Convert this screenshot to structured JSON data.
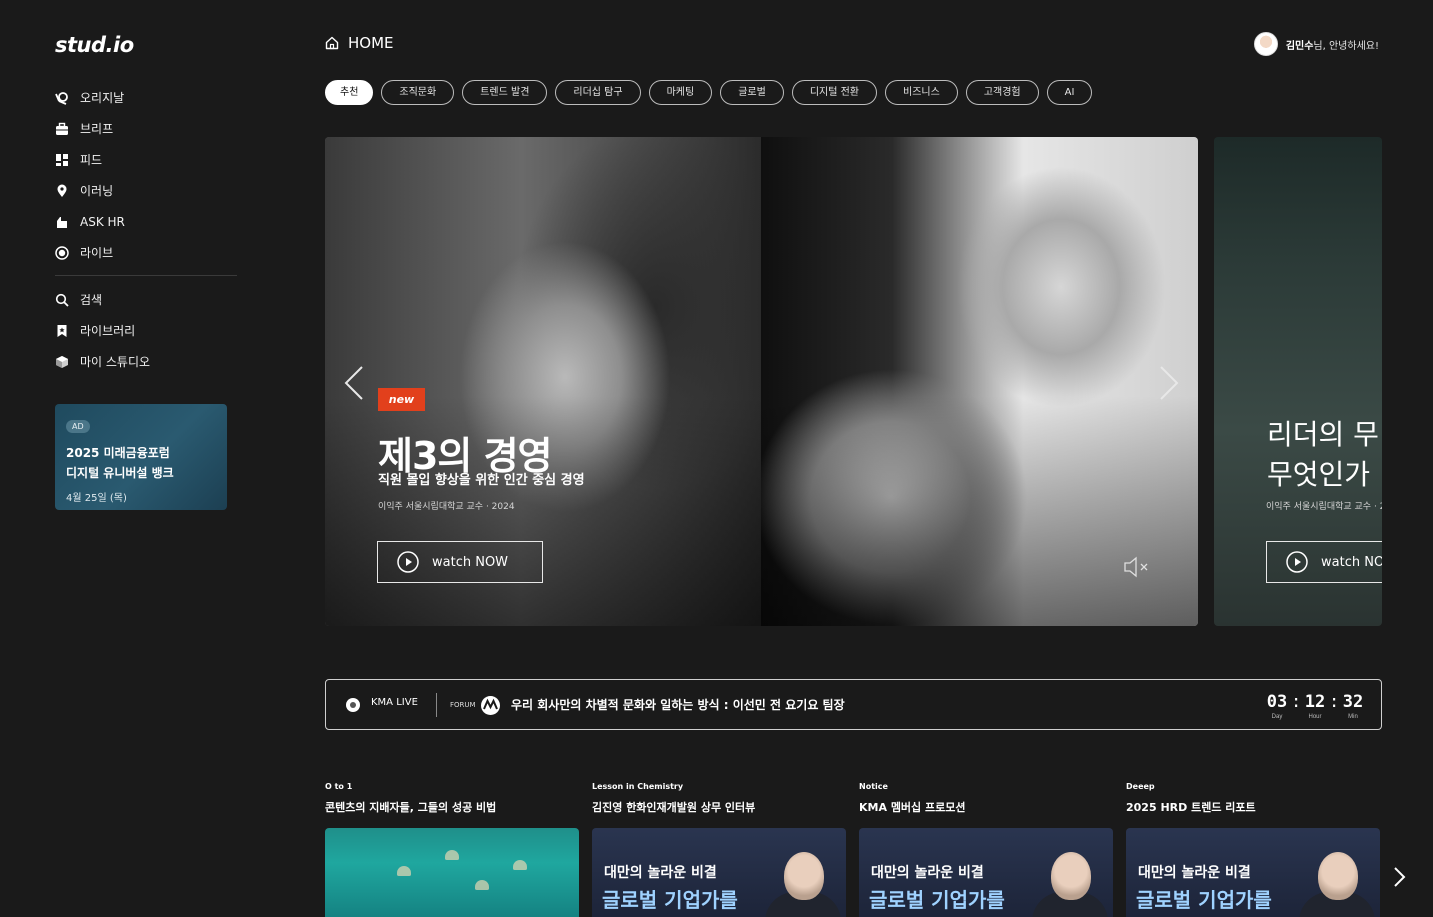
{
  "brand": {
    "logo": "stud.io"
  },
  "sidebar": {
    "main_items": [
      {
        "label": "오리지날",
        "icon": "original-icon"
      },
      {
        "label": "브리프",
        "icon": "briefcase-icon"
      },
      {
        "label": "피드",
        "icon": "grid-icon"
      },
      {
        "label": "이러닝",
        "icon": "pin-icon"
      },
      {
        "label": "ASK HR",
        "icon": "hand-icon"
      },
      {
        "label": "라이브",
        "icon": "live-icon"
      }
    ],
    "sub_items": [
      {
        "label": "검색",
        "icon": "search-icon"
      },
      {
        "label": "라이브러리",
        "icon": "bookmark-icon"
      },
      {
        "label": "마이 스튜디오",
        "icon": "cube-icon"
      }
    ],
    "ad": {
      "badge": "AD",
      "title_line1": "2025 미래금융포럼",
      "title_line2": "디지털 유니버설 뱅크",
      "date": "4월 25일 (목)"
    }
  },
  "header": {
    "home_label": "HOME",
    "user_name": "김민수",
    "user_greeting": "님, 안녕하세요!"
  },
  "categories": [
    "추천",
    "조직문화",
    "트렌드 발견",
    "리더십 탐구",
    "마케팅",
    "글로벌",
    "디지털 전환",
    "비즈니스",
    "고객경험",
    "AI"
  ],
  "active_category": "추천",
  "hero": {
    "badge": "new",
    "title": "제3의 경영",
    "subtitle": "직원 몰입 향상을 위한 인간 중심 경영",
    "meta": "이익주 서울시립대학교 교수 · 2024",
    "watch_label": "watch NOW"
  },
  "peek": {
    "title_line1": "리더의 무",
    "title_line2": "무엇인가",
    "meta": "이익주 서울시립대학교 교수 · 2",
    "watch_label": "watch NO"
  },
  "live": {
    "label": "KMA LIVE",
    "forum": "FORUM",
    "title": "우리 회사만의 차별적 문화와 일하는 방식 : 이선민 전 요기요 팀장",
    "timer": {
      "day": "03",
      "hour": "12",
      "min": "32",
      "day_label": "Day",
      "hour_label": "Hour",
      "min_label": "Min"
    }
  },
  "cards": [
    {
      "category": "O to 1",
      "title": "콘텐츠의 지배자들, 그들의 성공 비법",
      "image": "sea"
    },
    {
      "category": "Lesson in Chemistry",
      "title": "김진영 한화인재개발원 상무 인터뷰",
      "image": "talk",
      "overlay1": "대만의 놀라운 비결",
      "overlay2": "글로벌 기업가를"
    },
    {
      "category": "Notice",
      "title": "KMA 멤버십 프로모션",
      "image": "talk",
      "overlay1": "대만의 놀라운 비결",
      "overlay2": "글로벌 기업가를"
    },
    {
      "category": "Deeep",
      "title": "2025 HRD 트렌드 리포트",
      "image": "talk",
      "overlay1": "대만의 놀라운 비결",
      "overlay2": "글로벌 기업가를"
    }
  ],
  "colors": {
    "background": "#1a1a1a",
    "new_badge": "#e2401c",
    "ad_bg": "#1f4a5e"
  }
}
